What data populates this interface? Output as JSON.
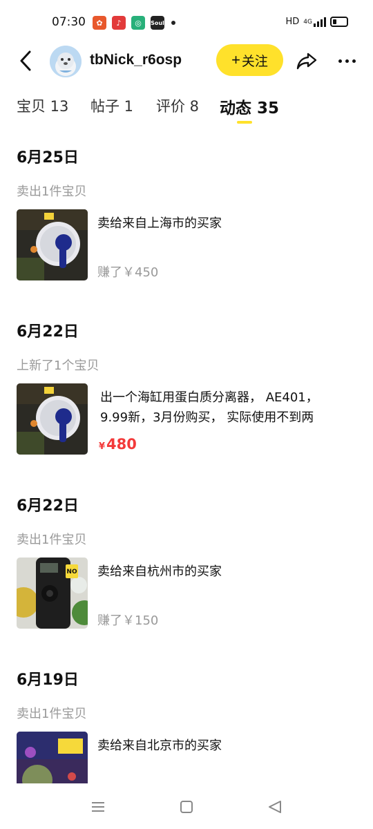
{
  "status_bar": {
    "time": "07:30",
    "apps": [
      "soul-like-app-icon",
      "music-app-icon",
      "green-app-icon",
      "soul-app-icon"
    ],
    "app4_label": "Soul",
    "network": "HD",
    "network_type": "4G"
  },
  "header": {
    "username": "tbNick_r6osp",
    "follow_label": "关注",
    "follow_color": "#ffe12b"
  },
  "tabs": [
    {
      "label": "宝贝 13"
    },
    {
      "label": "帖子 1"
    },
    {
      "label": "评价 8"
    },
    {
      "label": "动态 35",
      "active": true
    }
  ],
  "feed": [
    {
      "date": "6月25日",
      "action": "卖出1件宝贝",
      "title": "卖给来自上海市的买家",
      "sub": "赚了￥450"
    },
    {
      "date": "6月22日",
      "action": "上新了1个宝贝",
      "title": "出一个海缸用蛋白质分离器， AE401，9.99新，3月份购买， 实际使用不到两",
      "price_symbol": "¥",
      "price": "480"
    },
    {
      "date": "6月22日",
      "action": "卖出1件宝贝",
      "title": "卖给来自杭州市的买家",
      "sub": "赚了￥150",
      "badge_text": "NO"
    },
    {
      "date": "6月19日",
      "action": "卖出1件宝贝",
      "title": "卖给来自北京市的买家"
    }
  ],
  "colors": {
    "accent": "#ffe12b",
    "price_red": "#f33a3a",
    "muted": "#999999"
  }
}
